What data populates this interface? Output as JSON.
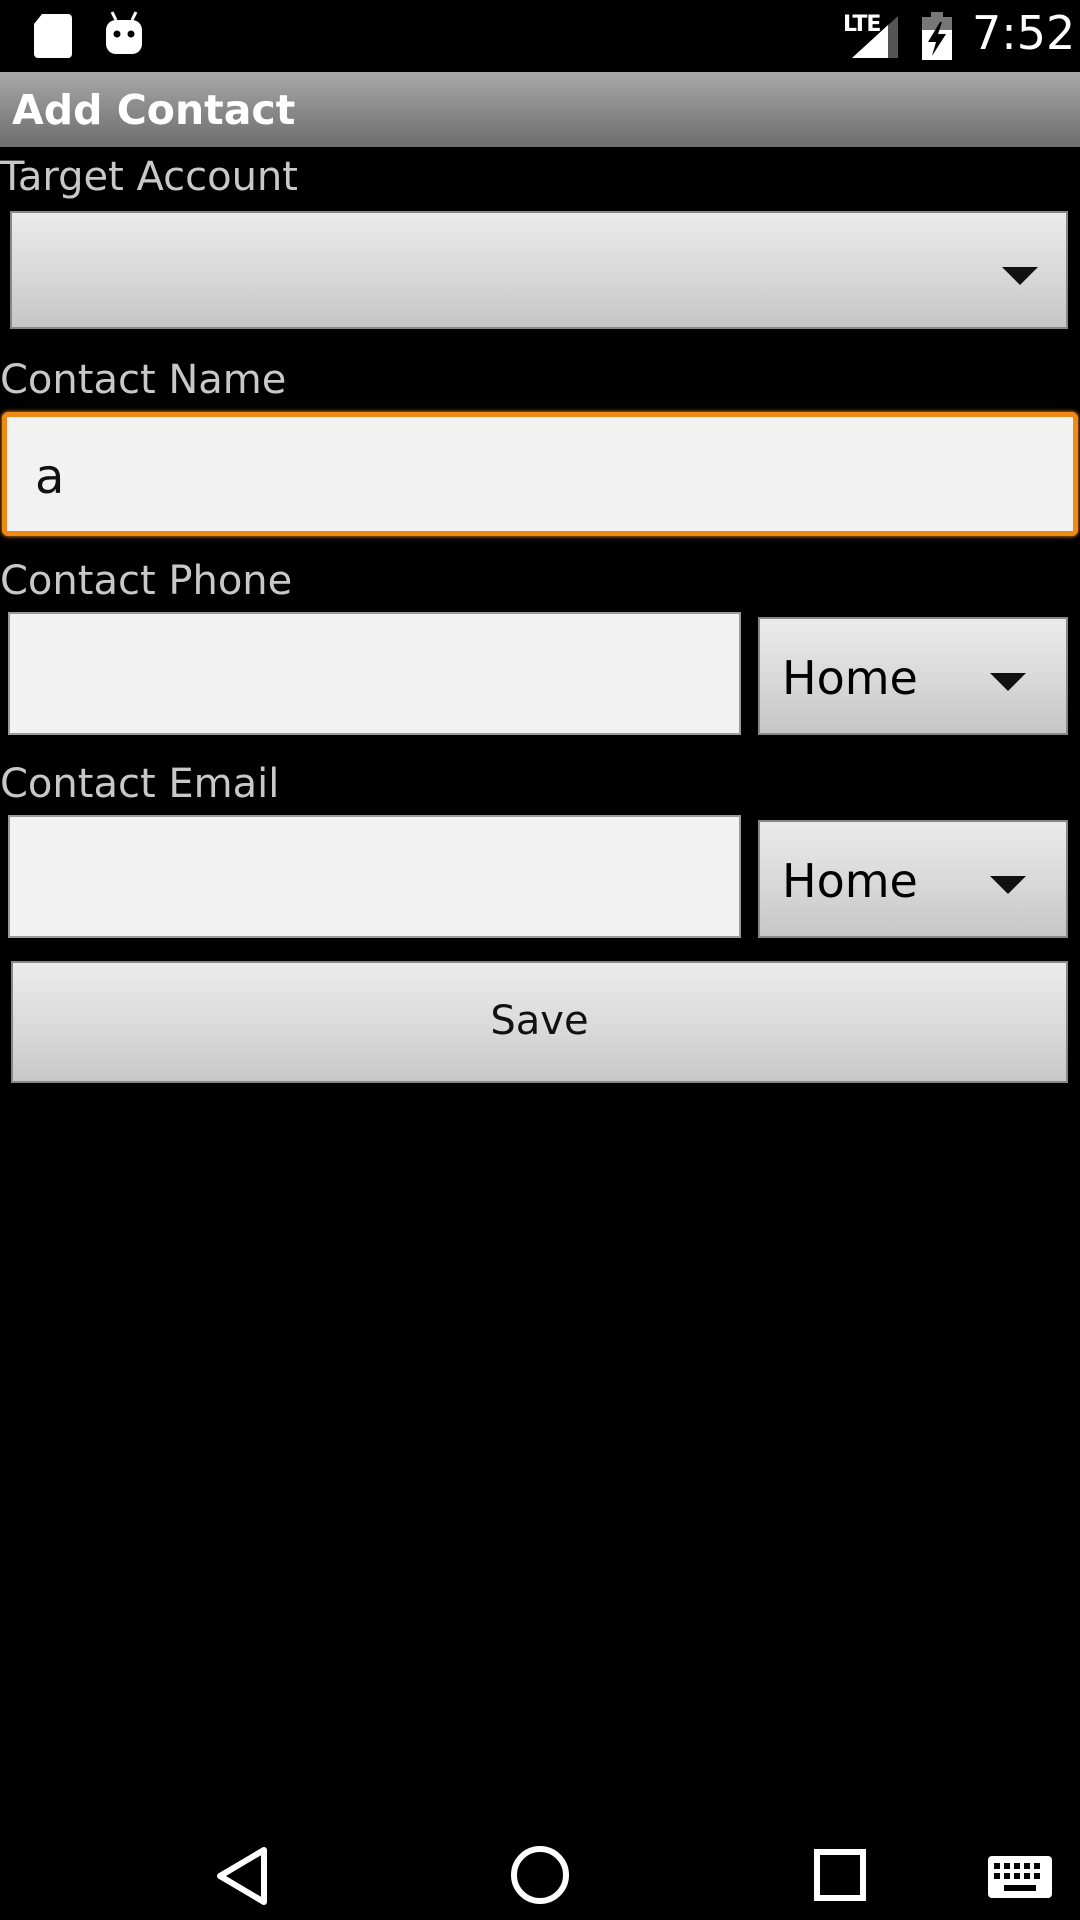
{
  "status_bar": {
    "time": "7:52",
    "network": "LTE",
    "icons": [
      "sd-card-icon",
      "android-debug-icon",
      "signal-icon",
      "battery-charging-icon"
    ]
  },
  "action_bar": {
    "title": "Add Contact"
  },
  "form": {
    "target_account": {
      "label": "Target Account",
      "selected": ""
    },
    "contact_name": {
      "label": "Contact Name",
      "value": "a"
    },
    "contact_phone": {
      "label": "Contact Phone",
      "value": "",
      "type_selected": "Home"
    },
    "contact_email": {
      "label": "Contact Email",
      "value": "",
      "type_selected": "Home"
    },
    "save_label": "Save"
  },
  "nav_bar": {
    "icons": [
      "back-icon",
      "home-icon",
      "recents-icon",
      "keyboard-icon"
    ]
  },
  "colors": {
    "background": "#000000",
    "focus_accent": "#f08a17",
    "label_text": "#c8c8c8"
  }
}
